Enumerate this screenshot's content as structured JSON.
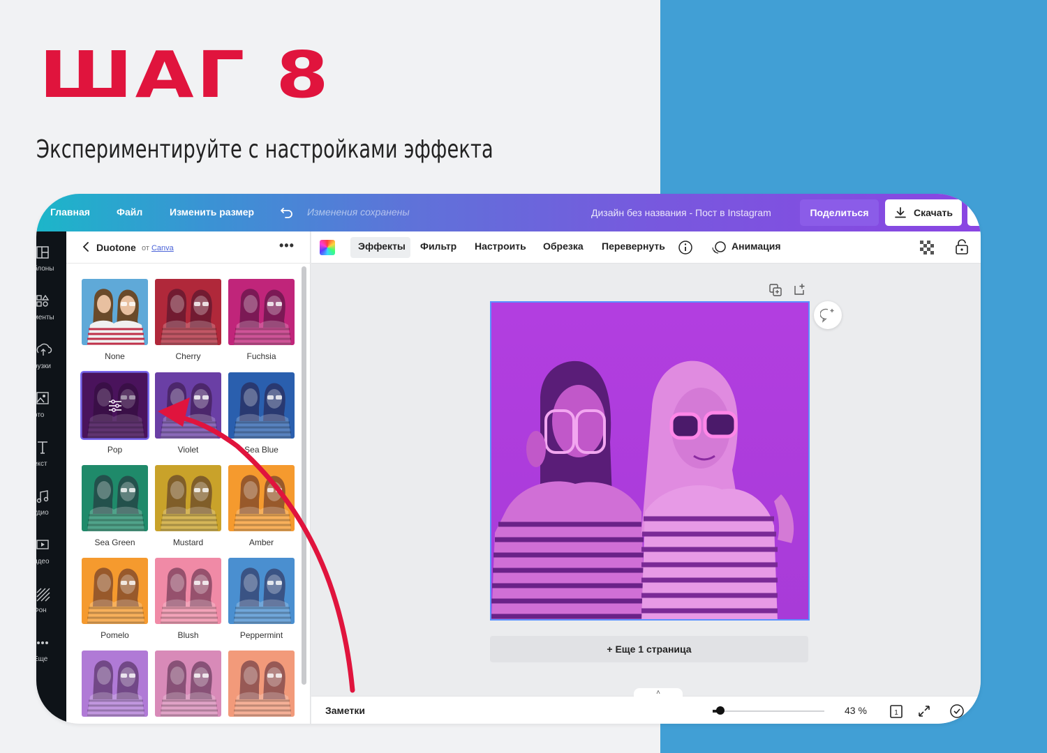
{
  "slide": {
    "step_title": "ШАГ 8",
    "subtitle": "Экспериментируйте с настройками эффекта"
  },
  "colors": {
    "accent_red": "#e0143d",
    "right_panel_blue": "#419fd5",
    "topbar_gradient_start": "#1cb6c9",
    "topbar_gradient_end": "#8a45e2",
    "share_button": "#8b5ce8",
    "duotone_tint": "#b23ee0"
  },
  "topbar": {
    "home": "Главная",
    "file": "Файл",
    "resize": "Изменить размер",
    "undo_icon": "undo-icon",
    "saved_status": "Изменения сохранены",
    "design_title": "Дизайн без названия - Пост в Instagram",
    "share": "Поделиться",
    "download": "Скачать",
    "download_icon": "download-icon"
  },
  "rail": [
    {
      "label": "блоны",
      "icon": "templates-icon"
    },
    {
      "label": "менты",
      "icon": "elements-icon"
    },
    {
      "label": "рузки",
      "icon": "upload-icon"
    },
    {
      "label": "ото",
      "icon": "photo-icon"
    },
    {
      "label": "екст",
      "icon": "text-icon"
    },
    {
      "label": "удио",
      "icon": "audio-icon"
    },
    {
      "label": "идео",
      "icon": "video-icon"
    },
    {
      "label": "Фон",
      "icon": "background-icon"
    },
    {
      "label": "Еще",
      "icon": "more-icon"
    }
  ],
  "panel": {
    "title": "Duotone",
    "by": "от",
    "by_link": "Canva",
    "menu_icon": "more-dots-icon",
    "filters": [
      {
        "name": "None",
        "color": "none",
        "selected": false
      },
      {
        "name": "Cherry",
        "color": "#b0283a",
        "selected": false
      },
      {
        "name": "Fuchsia",
        "color": "#c0257a",
        "selected": false
      },
      {
        "name": "Pop",
        "color": "#5c1a6e",
        "selected": true
      },
      {
        "name": "Violet",
        "color": "#6a3fa5",
        "selected": false
      },
      {
        "name": "Sea Blue",
        "color": "#2a5fae",
        "selected": false
      },
      {
        "name": "Sea Green",
        "color": "#1f8a6a",
        "selected": false
      },
      {
        "name": "Mustard",
        "color": "#c9a22a",
        "selected": false
      },
      {
        "name": "Amber",
        "color": "#f59a2e",
        "selected": false
      },
      {
        "name": "Pomelo",
        "color": "#f59a2e",
        "selected": false
      },
      {
        "name": "Blush",
        "color": "#f08aa6",
        "selected": false
      },
      {
        "name": "Peppermint",
        "color": "#4a8fd0",
        "selected": false
      },
      {
        "name": "",
        "color": "#b07ad6",
        "selected": false
      },
      {
        "name": "",
        "color": "#d88ab8",
        "selected": false
      },
      {
        "name": "",
        "color": "#f29a7a",
        "selected": false
      }
    ]
  },
  "toolbar": {
    "color_icon": "color-palette-icon",
    "effects": "Эффекты",
    "filter": "Фильтр",
    "adjust": "Настроить",
    "crop": "Обрезка",
    "flip": "Перевернуть",
    "info_icon": "info-icon",
    "animation": "Анимация",
    "animation_icon": "animation-icon",
    "transparency_icon": "transparency-icon",
    "lock_icon": "lock-icon"
  },
  "canvas": {
    "add_page": "+ Еще 1 страница",
    "duplicate_icon": "duplicate-page-icon",
    "add_page_icon": "add-page-icon",
    "comment_icon": "add-comment-icon"
  },
  "bottombar": {
    "notes": "Заметки",
    "zoom": "43 %",
    "zoom_level": 0.43,
    "page_icon": "page-count-icon",
    "page_number": "1",
    "fullscreen_icon": "fullscreen-icon",
    "check_icon": "check-circle-icon",
    "collapse_icon": "chevron-up-icon"
  }
}
